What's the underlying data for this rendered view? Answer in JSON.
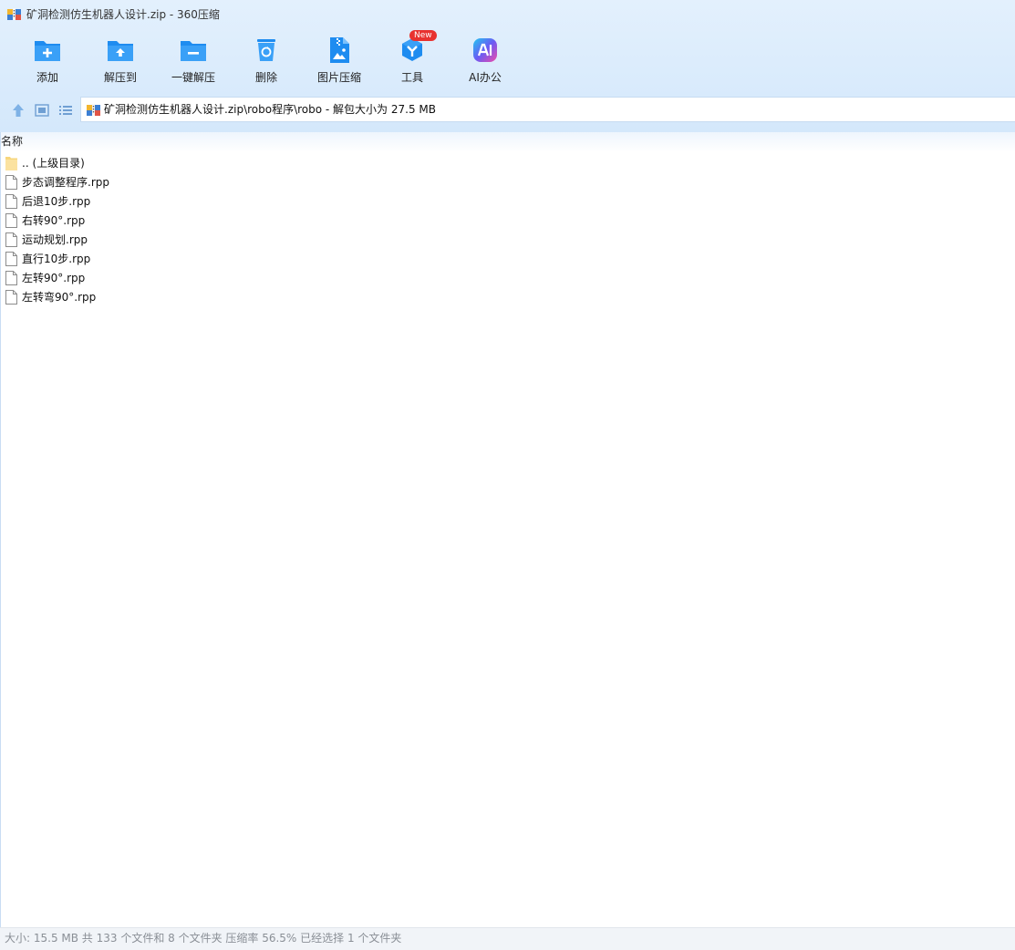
{
  "window": {
    "title": "矿洞检测仿生机器人设计.zip - 360压缩"
  },
  "toolbar": {
    "items": [
      {
        "label": "添加",
        "icon": "add-folder-icon"
      },
      {
        "label": "解压到",
        "icon": "extract-to-icon"
      },
      {
        "label": "一键解压",
        "icon": "one-click-extract-icon"
      },
      {
        "label": "删除",
        "icon": "recycle-bin-icon"
      },
      {
        "label": "图片压缩",
        "icon": "image-compress-icon"
      },
      {
        "label": "工具",
        "icon": "tools-icon",
        "badge": "New"
      },
      {
        "label": "AI办公",
        "icon": "ai-office-icon"
      }
    ]
  },
  "navigation": {
    "address": "矿洞检测仿生机器人设计.zip\\robo程序\\robo - 解包大小为 27.5 MB"
  },
  "file_list": {
    "column_header": "名称",
    "rows": [
      {
        "name": ".. (上级目录)",
        "type": "folder"
      },
      {
        "name": "步态调整程序.rpp",
        "type": "file"
      },
      {
        "name": "后退10步.rpp",
        "type": "file"
      },
      {
        "name": "右转90°.rpp",
        "type": "file"
      },
      {
        "name": "运动规划.rpp",
        "type": "file"
      },
      {
        "name": "直行10步.rpp",
        "type": "file"
      },
      {
        "name": "左转90°.rpp",
        "type": "file"
      },
      {
        "name": "左转弯90°.rpp",
        "type": "file"
      }
    ]
  },
  "status": {
    "text": "大小: 15.5 MB 共 133 个文件和 8 个文件夹 压缩率 56.5% 已经选择 1 个文件夹"
  },
  "colors": {
    "toolbar_bg": "#d4e8fb",
    "accent_blue": "#1e8cf0",
    "badge_red": "#e8322f",
    "status_text": "#8a8f96"
  }
}
